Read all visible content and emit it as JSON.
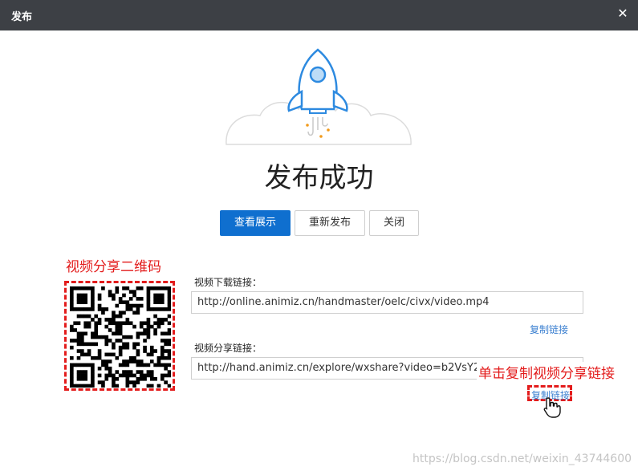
{
  "titlebar": {
    "title": "发布",
    "close_glyph": "✕"
  },
  "icons": {
    "rocket": "rocket-icon",
    "close": "close-icon",
    "hand_cursor": "hand-cursor-icon"
  },
  "heading": "发布成功",
  "buttons": {
    "view": "查看展示",
    "republish": "重新发布",
    "close": "关闭"
  },
  "qr": {
    "annotation": "视频分享二维码"
  },
  "download": {
    "label": "视频下载链接：",
    "value": "http://online.animiz.cn/handmaster/oelc/civx/video.mp4",
    "copy": "复制链接"
  },
  "share": {
    "label": "视频分享链接：",
    "value": "http://hand.animiz.cn/explore/wxshare?video=b2VsY2N",
    "copy": "复制链接",
    "annotation": "单击复制视频分享链接"
  },
  "watermark": "https://blog.csdn.net/weixin_43744600",
  "colors": {
    "primary": "#0f6fcf",
    "annotation": "#e31c1c",
    "link": "#3a7fd0",
    "titlebar": "#3d4045"
  }
}
